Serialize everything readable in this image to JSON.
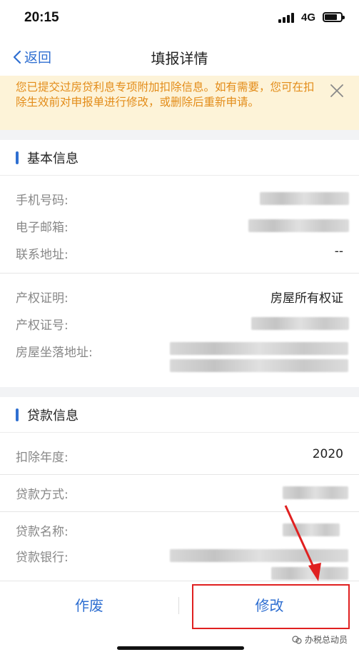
{
  "status_bar": {
    "time": "20:15",
    "network": "4G",
    "battery_level": 0.7
  },
  "nav": {
    "back_label": "返回",
    "title": "填报详情"
  },
  "notice": {
    "text": "您已提交过房贷利息专项附加扣除信息。如有需要，您可在扣除生效前对申报单进行修改，或删除后重新申请。"
  },
  "basic_info": {
    "title": "基本信息",
    "phone_label": "手机号码:",
    "email_label": "电子邮箱:",
    "address_label": "联系地址:",
    "address_value": "--"
  },
  "property": {
    "cert_label": "产权证明:",
    "cert_value": "房屋所有权证",
    "cert_no_label": "产权证号:",
    "location_label": "房屋坐落地址:"
  },
  "loan_info": {
    "title": "贷款信息",
    "year_label": "扣除年度:",
    "year_value": "2020",
    "method_label": "贷款方式:",
    "name_label": "贷款名称:",
    "bank_label": "贷款银行:"
  },
  "actions": {
    "void_label": "作废",
    "modify_label": "修改"
  },
  "watermark": {
    "text": "办税总动员"
  },
  "colors": {
    "accent": "#2f6fd1",
    "notice_bg": "#fdf3d8",
    "notice_text": "#e38c19",
    "highlight": "#e02020"
  }
}
